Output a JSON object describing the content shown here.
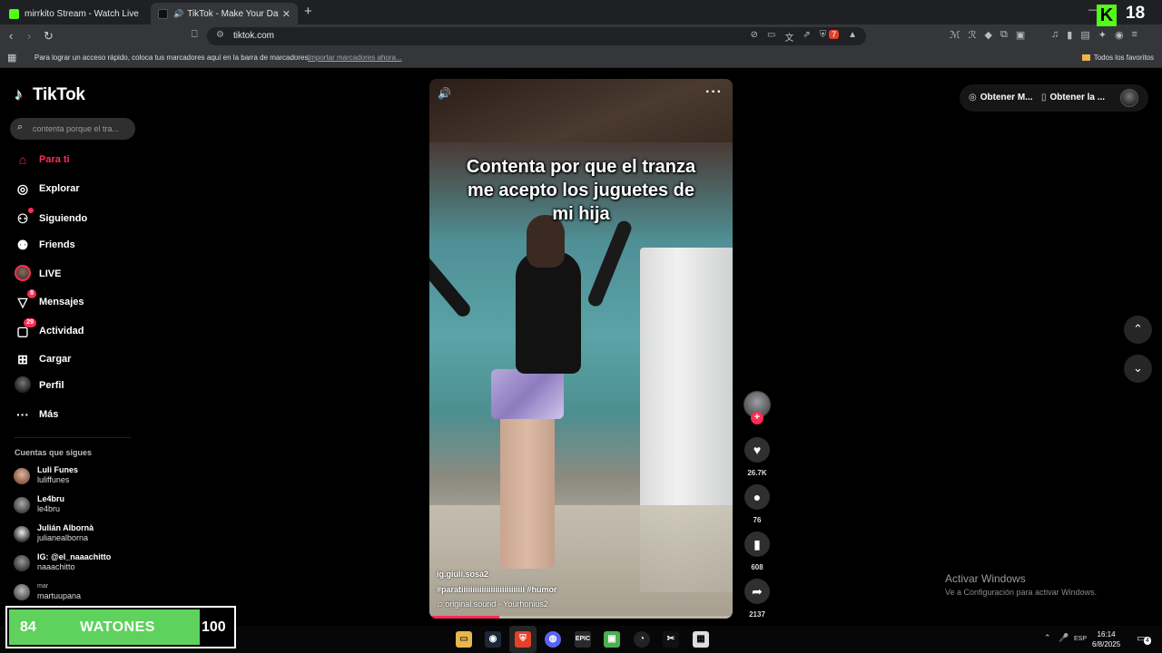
{
  "browser": {
    "tabs": [
      {
        "title": "mirrkito Stream - Watch Live on Kick"
      },
      {
        "title": "TikTok - Make Your Day"
      }
    ],
    "url": "tiktok.com",
    "bookmarks_msg": "Para lograr un acceso rápido, coloca tus marcadores aquí en la barra de marcadores.",
    "bookmarks_import": "Importar marcadores ahora...",
    "bookmarks_all": "Todos los favoritos",
    "brave_count": "7"
  },
  "tiktok": {
    "logo": "TikTok",
    "search_placeholder": "contenta porque el tra...",
    "nav": [
      {
        "label": "Para ti",
        "icon": "home-icon"
      },
      {
        "label": "Explorar",
        "icon": "compass-icon"
      },
      {
        "label": "Siguiendo",
        "icon": "following-icon"
      },
      {
        "label": "Friends",
        "icon": "friends-icon"
      },
      {
        "label": "LIVE",
        "icon": "live-avatar"
      },
      {
        "label": "Mensajes",
        "icon": "messages-icon",
        "badge": "8"
      },
      {
        "label": "Actividad",
        "icon": "activity-icon",
        "badge": "29"
      },
      {
        "label": "Cargar",
        "icon": "upload-icon"
      },
      {
        "label": "Perfil",
        "icon": "profile-icon"
      },
      {
        "label": "Más",
        "icon": "more-icon"
      }
    ],
    "following_title": "Cuentas que sigues",
    "following": [
      {
        "name": "Luli Funes",
        "username": "luliffunes"
      },
      {
        "name": "Le4bru",
        "username": "le4bru"
      },
      {
        "name": "Julián Albornà",
        "username": "julianealborna"
      },
      {
        "name": "IG: @el_naaachitto",
        "username": "naaachitto"
      },
      {
        "name": "mar",
        "username": "martuupana"
      }
    ],
    "top_right": {
      "get_app_1": "Obtener M...",
      "get_app_2": "Obtener la ..."
    },
    "video": {
      "caption": "Contenta por que el tranza me acepto los juguetes de mi hija",
      "author": "ig.giuli.sosa2",
      "tags": "#paratiiiiiiiiiiiiiiiiiiiiiiiiiiii #humor",
      "sound": "original sound - Yourhonius2",
      "progress": 0.23
    },
    "actions": {
      "likes": "26.7K",
      "comments": "76",
      "saves": "608",
      "shares": "2137"
    }
  },
  "windows": {
    "activate_title": "Activar Windows",
    "activate_sub": "Ve a Configuración para activar Windows.",
    "time": "16:14",
    "date": "6/8/2025",
    "lang": "ESP",
    "notif_count": "4"
  },
  "stream_overlay": {
    "age_rating": "18",
    "score_left": "84",
    "score_label": "WATONES",
    "score_right": "100",
    "score_fill": 0.84
  },
  "colors": {
    "accent": "#fe2c55",
    "kick_green": "#53fc18",
    "score_green": "#5ed25c"
  }
}
